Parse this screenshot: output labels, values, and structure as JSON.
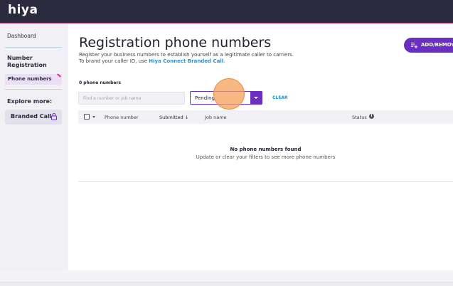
{
  "header": {
    "logo": "hiya"
  },
  "sidebar": {
    "dashboard": "Dashboard",
    "section_title": "Number Registration",
    "active_item": "Phone numbers",
    "explore_label": "Explore more:",
    "branded_call": "Branded Call",
    "branded_call_icon": "lock-icon"
  },
  "main": {
    "title": "Registration phone numbers",
    "subtitle_part1": "Register your business numbers to establish yourself as a legitimate caller to carriers. To brand your caller ID, use ",
    "subtitle_link": "Hiya Connect Branded Call",
    "subtitle_end": ".",
    "add_button": "ADD/REMOVE",
    "add_icon": "list-add-icon",
    "count": "0 phone numbers",
    "search_placeholder": "Find a number or job name",
    "status_filter": "Pending",
    "clear": "CLEAR",
    "columns": {
      "phone": "Phone number",
      "submitted": "Submitted ↓",
      "job": "Job name",
      "status": "Status"
    },
    "empty_title": "No phone numbers found",
    "empty_sub": "Update or clear your filters to see more phone numbers"
  },
  "colors": {
    "accent": "#6b2ec2",
    "link": "#2b8fd1",
    "topbar": "#2c2a3f"
  }
}
